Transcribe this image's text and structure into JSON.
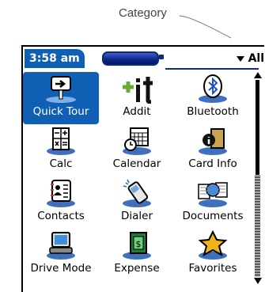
{
  "callout": {
    "label": "Category"
  },
  "status": {
    "time": "3:58 am",
    "category": "All"
  },
  "apps": [
    {
      "label": "Quick Tour",
      "icon": "quick-tour-icon",
      "selected": true
    },
    {
      "label": "Addit",
      "icon": "addit-icon"
    },
    {
      "label": "Bluetooth",
      "icon": "bluetooth-icon"
    },
    {
      "label": "Calc",
      "icon": "calculator-icon"
    },
    {
      "label": "Calendar",
      "icon": "calendar-icon"
    },
    {
      "label": "Card Info",
      "icon": "card-info-icon"
    },
    {
      "label": "Contacts",
      "icon": "contacts-icon"
    },
    {
      "label": "Dialer",
      "icon": "dialer-icon"
    },
    {
      "label": "Documents",
      "icon": "documents-icon"
    },
    {
      "label": "Drive Mode",
      "icon": "drive-mode-icon"
    },
    {
      "label": "Expense",
      "icon": "expense-icon"
    },
    {
      "label": "Favorites",
      "icon": "favorites-icon"
    }
  ],
  "colors": {
    "highlight": "#0f5fb5",
    "battery": "#0b2584"
  }
}
